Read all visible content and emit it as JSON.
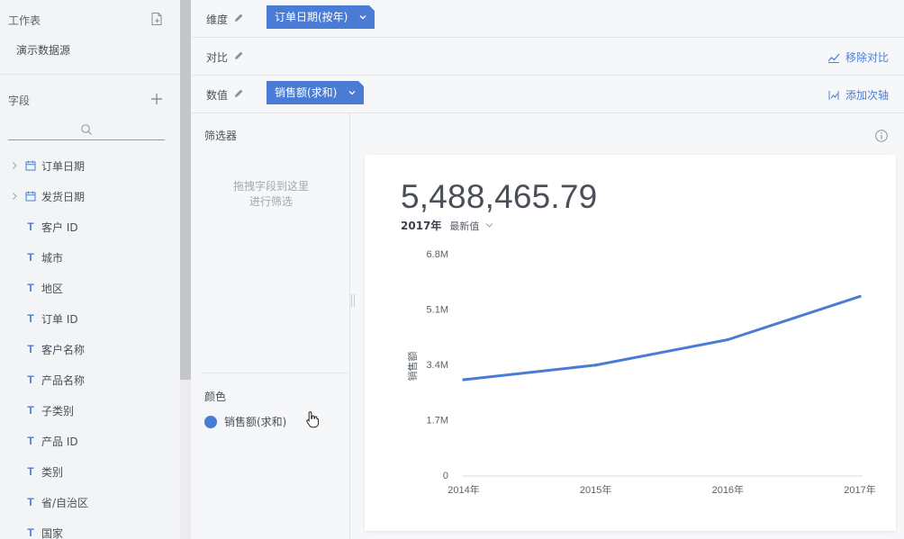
{
  "sidebar": {
    "worksheet_title": "工作表",
    "datasource": "演示数据源",
    "fields_title": "字段",
    "search_placeholder": "",
    "fields": [
      {
        "label": "订单日期",
        "type": "date",
        "expandable": true
      },
      {
        "label": "发货日期",
        "type": "date",
        "expandable": true
      },
      {
        "label": "客户 ID",
        "type": "text"
      },
      {
        "label": "城市",
        "type": "text"
      },
      {
        "label": "地区",
        "type": "text"
      },
      {
        "label": "订单 ID",
        "type": "text"
      },
      {
        "label": "客户名称",
        "type": "text"
      },
      {
        "label": "产品名称",
        "type": "text"
      },
      {
        "label": "子类别",
        "type": "text"
      },
      {
        "label": "产品 ID",
        "type": "text"
      },
      {
        "label": "类别",
        "type": "text"
      },
      {
        "label": "省/自治区",
        "type": "text"
      },
      {
        "label": "国家",
        "type": "text"
      }
    ]
  },
  "shelves": {
    "dimension": {
      "label": "维度",
      "pill": "订单日期(按年)"
    },
    "compare": {
      "label": "对比",
      "action": "移除对比"
    },
    "measure": {
      "label": "数值",
      "pill": "销售额(求和)",
      "action": "添加次轴"
    }
  },
  "filter": {
    "title": "筛选器",
    "hint_line1": "拖拽字段到这里",
    "hint_line2": "进行筛选"
  },
  "color": {
    "title": "颜色",
    "legend_label": "销售额(求和)",
    "swatch": "#4a7cd6"
  },
  "kpi": {
    "value": "5,488,465.79",
    "period": "2017年",
    "aggregation": "最新值"
  },
  "colors": {
    "accent": "#4a7cd6",
    "line": "#4a7cd6"
  },
  "chart_data": {
    "type": "line",
    "categories": [
      "2014年",
      "2015年",
      "2016年",
      "2017年"
    ],
    "series": [
      {
        "values": [
          2930000,
          3380000,
          4160000,
          5488465.79
        ]
      }
    ],
    "ylabel": "销售额",
    "yticks": [
      "0",
      "1.7M",
      "3.4M",
      "5.1M",
      "6.8M"
    ],
    "ylim": [
      0,
      6800000
    ],
    "grid": false,
    "legend": "none"
  }
}
